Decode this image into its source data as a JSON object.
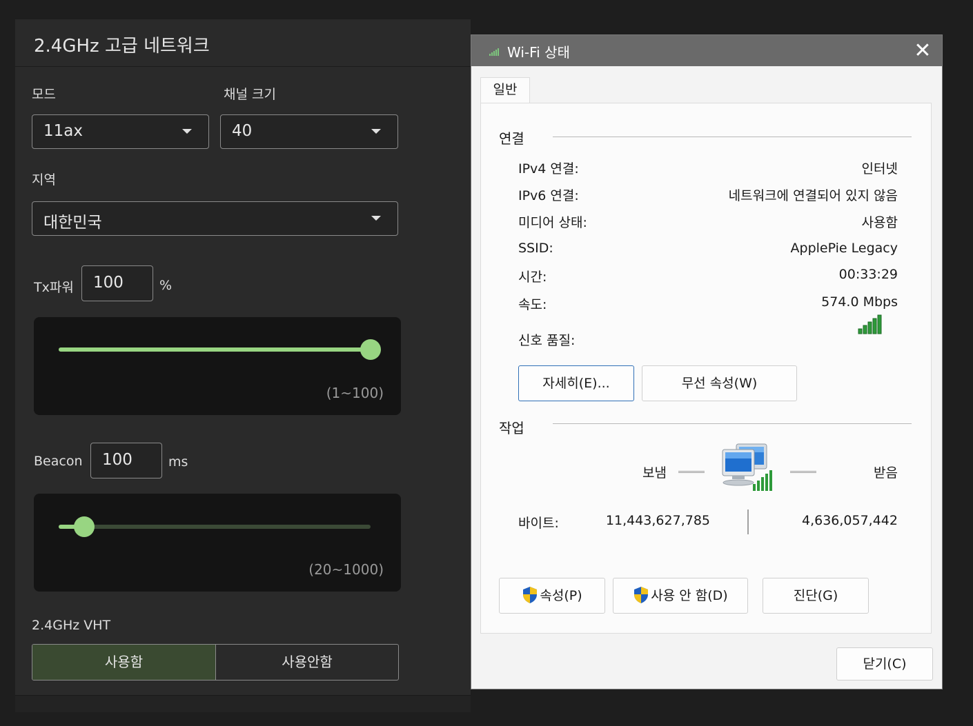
{
  "left_panel": {
    "title": "2.4GHz 고급 네트워크",
    "mode_label": "모드",
    "mode_value": "11ax",
    "channel_label": "채널 크기",
    "channel_value": "40",
    "region_label": "지역",
    "region_value": "대한민국",
    "tx_label": "Tx파워",
    "tx_value": "100",
    "tx_unit": "%",
    "tx_range": "(1~100)",
    "tx_slider_level": 100,
    "beacon_label": "Beacon",
    "beacon_value": "100",
    "beacon_unit": "ms",
    "beacon_range": "(20~1000)",
    "beacon_slider_level": 100,
    "vht_label": "2.4GHz VHT",
    "vht_on": "사용함",
    "vht_off": "사용안함",
    "vht_selected": "사용함",
    "colors": {
      "accent": "#98d582",
      "selected_bg": "#3a4a31"
    }
  },
  "wifi_dialog": {
    "title": "Wi-Fi 상태",
    "tab": "일반",
    "connection_group": "연결",
    "rows": [
      {
        "label": "IPv4 연결:",
        "value": "인터넷"
      },
      {
        "label": "IPv6 연결:",
        "value": "네트워크에 연결되어 있지 않음"
      },
      {
        "label": "미디어 상태:",
        "value": "사용함"
      },
      {
        "label": "SSID:",
        "value": "ApplePie Legacy"
      },
      {
        "label": "시간:",
        "value": "00:33:29"
      },
      {
        "label": "속도:",
        "value": "574.0 Mbps"
      }
    ],
    "signal_label": "신호 품질:",
    "signal_bars": 5,
    "details_button": "자세히(E)...",
    "wireless_props_button": "무선 속성(W)",
    "activity_group": "작업",
    "sent_label": "보냄",
    "received_label": "받음",
    "bytes_label": "바이트:",
    "bytes_sent": "11,443,627,785",
    "bytes_received": "4,636,057,442",
    "properties_button": "속성(P)",
    "disable_button": "사용 안 함(D)",
    "diagnose_button": "진단(G)",
    "close_button": "닫기(C)",
    "colors": {
      "signal": "#2e9a3a",
      "focus_border": "#2f6fb6",
      "titlebar": "#6a6a6a"
    }
  }
}
